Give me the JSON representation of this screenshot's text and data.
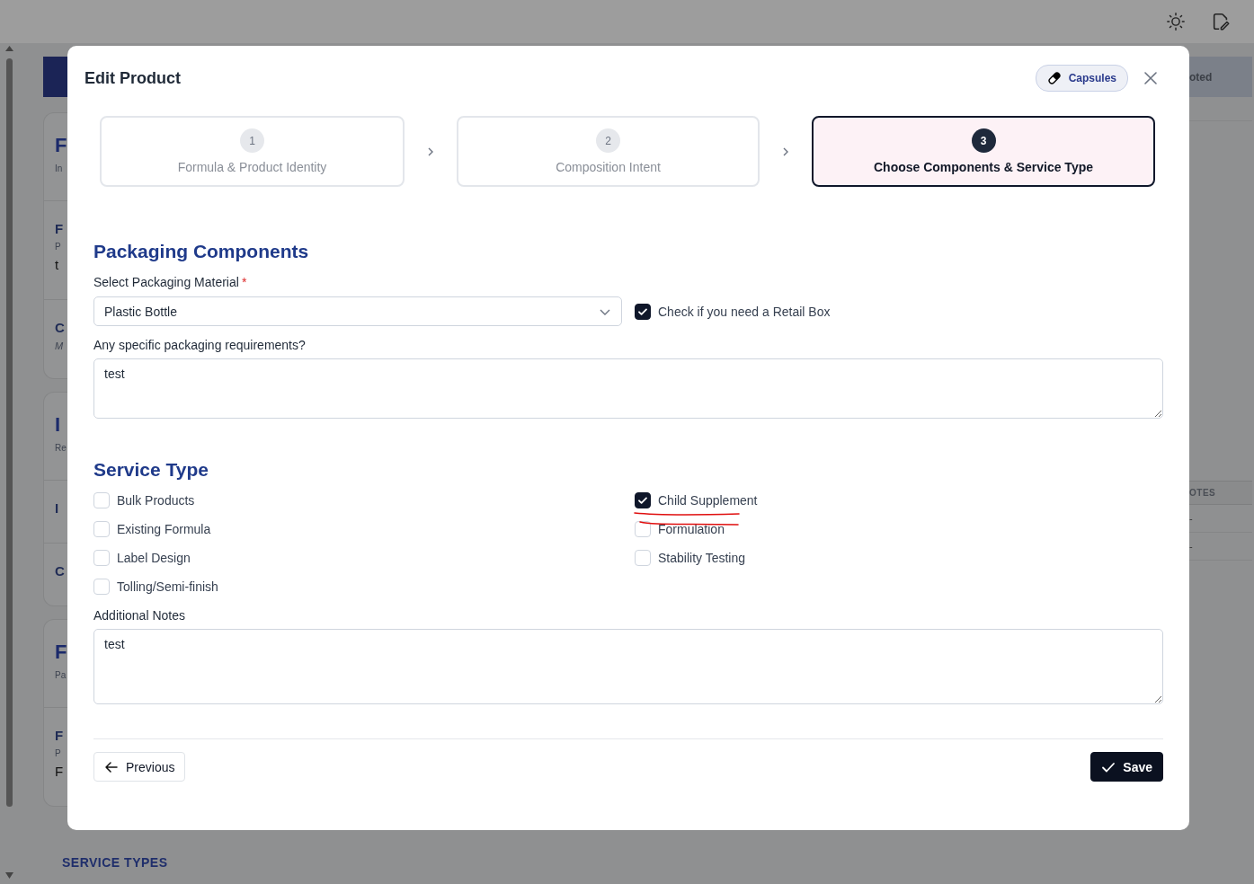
{
  "background": {
    "left_cards": [
      {
        "sections": [
          [
            {
              "text": "F",
              "kind": "title"
            },
            {
              "text": "In",
              "kind": "small"
            }
          ],
          [
            {
              "text": "F",
              "kind": "heading"
            },
            {
              "text": "P",
              "kind": "small"
            },
            {
              "text": "t",
              "kind": "value"
            }
          ],
          [
            {
              "text": "C",
              "kind": "heading"
            },
            {
              "text": "M",
              "kind": "italic"
            }
          ]
        ]
      },
      {
        "sections": [
          [
            {
              "text": "I",
              "kind": "title"
            },
            {
              "text": "Re",
              "kind": "small"
            }
          ],
          [
            {
              "text": "I",
              "kind": "heading"
            }
          ],
          [
            {
              "text": "C",
              "kind": "heading"
            }
          ]
        ]
      },
      {
        "sections": [
          [
            {
              "text": "F",
              "kind": "title"
            },
            {
              "text": "Pa",
              "kind": "small"
            }
          ],
          [
            {
              "text": "F",
              "kind": "heading"
            },
            {
              "text": "P",
              "kind": "small"
            },
            {
              "text": "F",
              "kind": "value"
            }
          ]
        ]
      }
    ],
    "right_header": "oted",
    "right_table_header": "OTES",
    "right_table_rows": [
      "-",
      "-"
    ],
    "bottom_heading": "SERVICE TYPES"
  },
  "modal": {
    "title": "Edit Product",
    "badge": "Capsules",
    "steps": [
      {
        "number": "1",
        "label": "Formula & Product Identity",
        "selected": false
      },
      {
        "number": "2",
        "label": "Composition Intent",
        "selected": false
      },
      {
        "number": "3",
        "label": "Choose Components & Service Type",
        "selected": true
      }
    ],
    "packaging": {
      "heading": "Packaging Components",
      "material_label": "Select Packaging Material",
      "required_mark": "*",
      "material_value": "Plastic Bottle",
      "retail_box": {
        "label": "Check if you need a Retail Box",
        "checked": true
      },
      "requirements_label": "Any specific packaging requirements?",
      "requirements_value": "test"
    },
    "service": {
      "heading": "Service Type",
      "options": [
        {
          "label": "Bulk Products",
          "checked": false
        },
        {
          "label": "Child Supplement",
          "checked": true
        },
        {
          "label": "Existing Formula",
          "checked": false
        },
        {
          "label": "Formulation",
          "checked": false
        },
        {
          "label": "Label Design",
          "checked": false
        },
        {
          "label": "Stability Testing",
          "checked": false
        },
        {
          "label": "Tolling/Semi-finish",
          "checked": false
        }
      ],
      "notes_label": "Additional Notes",
      "notes_value": "test"
    },
    "previous": "Previous",
    "save": "Save"
  }
}
